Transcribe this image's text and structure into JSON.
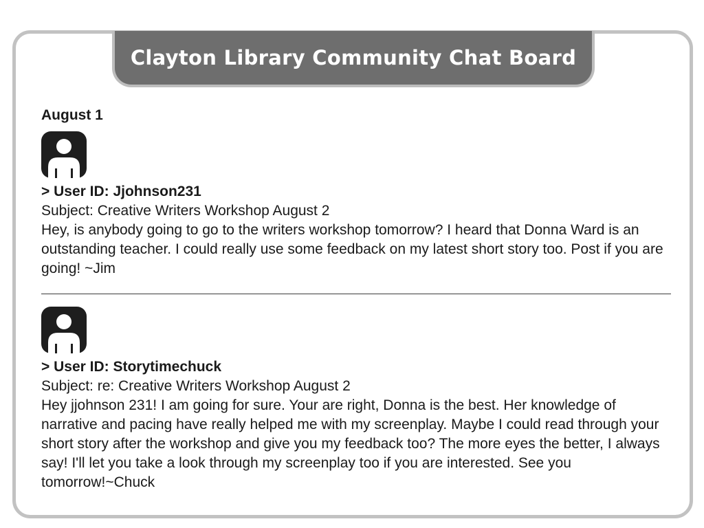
{
  "board": {
    "title": "Clayton Library Community Chat Board"
  },
  "date": "August 1",
  "posts": [
    {
      "user_id": "> User ID: Jjohnson231",
      "subject": "Subject: Creative Writers Workshop August 2",
      "body": "Hey, is anybody going to go to the writers workshop tomorrow? I heard that Donna Ward is an outstanding teacher. I could really use some feedback on my latest short story too. Post if you are going! ~Jim",
      "avatar_icon": "user-avatar-icon"
    },
    {
      "user_id": "> User ID: Storytimechuck",
      "subject": "Subject: re: Creative Writers Workshop August 2",
      "body": "Hey jjohnson 231! I am going for sure. Your are right, Donna is the best. Her knowledge of narrative and pacing have really helped me with my screenplay. Maybe I could read through your short story after the workshop and give you my feedback too? The more eyes the better, I always say! I'll let you take a look through my screenplay too if you are interested. See you tomorrow!~Chuck",
      "avatar_icon": "user-avatar-icon"
    }
  ],
  "colors": {
    "banner": "#6e6e6e",
    "frame": "#c2c2c2",
    "avatar": "#1e1e1e"
  }
}
